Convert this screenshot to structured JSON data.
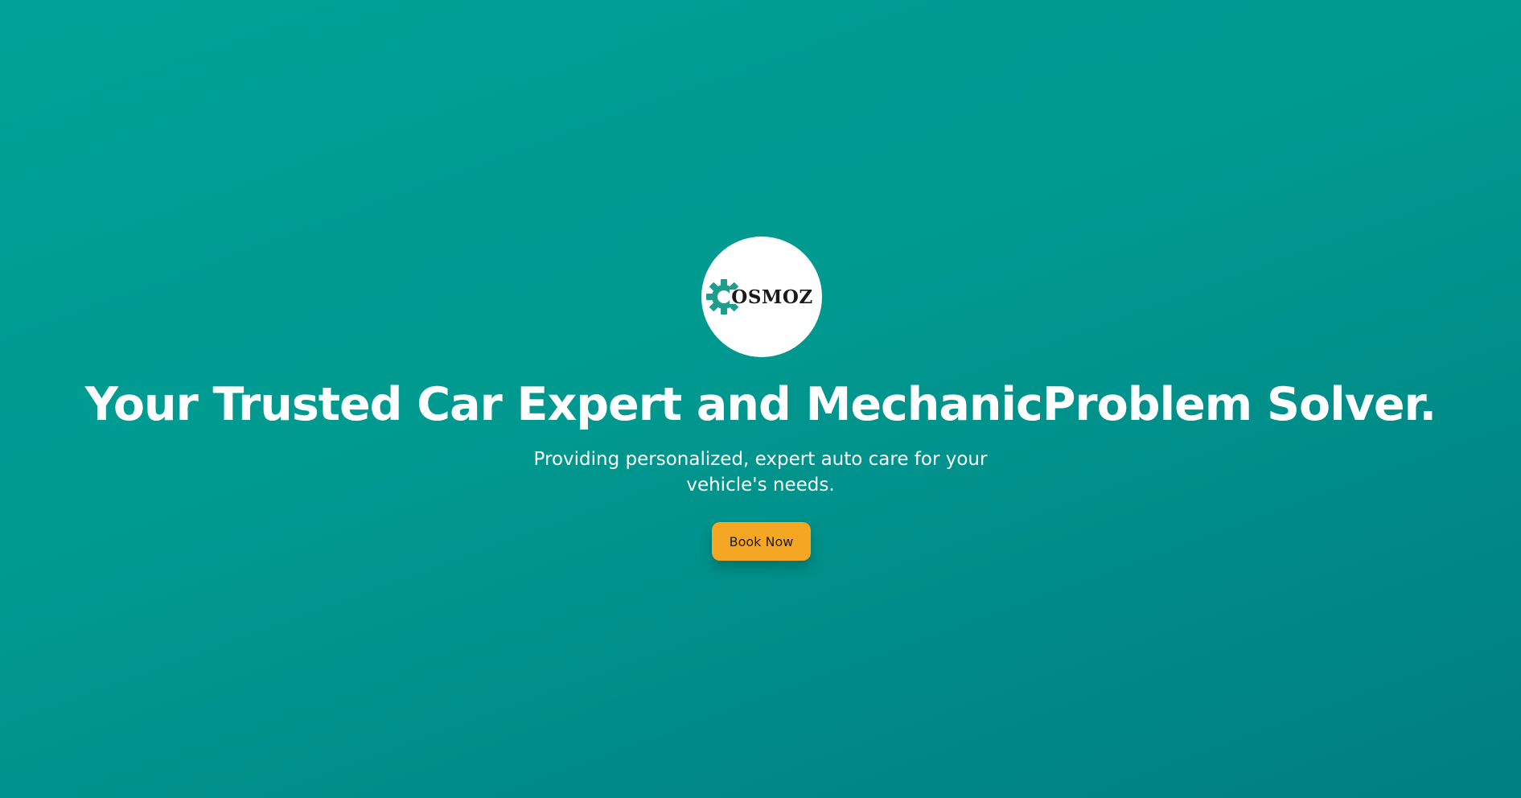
{
  "colors": {
    "background_start": "#00a196",
    "background_end": "#007f80",
    "accent": "#f5a623",
    "logo_gear": "#1e9c8c"
  },
  "logo": {
    "icon": "gear-icon",
    "text": "OSMOZ"
  },
  "hero": {
    "headline": "Your Trusted Car Expert and MechanicProblem Solver.",
    "subtitle": "Providing personalized, expert auto care for your vehicle's needs.",
    "cta_label": "Book Now"
  }
}
